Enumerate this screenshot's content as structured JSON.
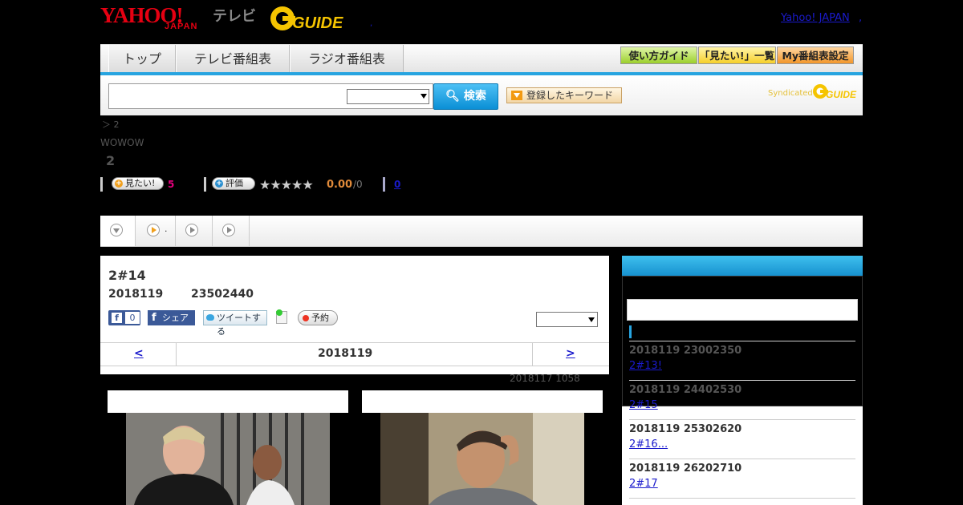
{
  "header": {
    "logo_yahoo": "YAHOO!",
    "logo_japan": "JAPAN",
    "logo_tv": "テレビ",
    "comma": ",",
    "yahoo_japan_link": "Yahoo! JAPAN",
    "yahoo_japan_link_suffix": ","
  },
  "nav": {
    "tabs": [
      "トップ",
      "テレビ番組表",
      "ラジオ番組表"
    ],
    "buttons": [
      "使い方ガイド",
      "「見たい!」一覧",
      "My番組表設定"
    ]
  },
  "search": {
    "button_label": "検索",
    "keyword_button_label": "登録したキーワード",
    "syndicated_label": "Syndicated"
  },
  "program": {
    "breadcrumb": "＞ 2",
    "channel": "WOWOW",
    "title": "2",
    "want_label": "見たい!",
    "want_count": "5",
    "rate_label": "評価",
    "stars": "★★★★★",
    "rating": "0.00",
    "rating_count": "/0",
    "review_count": "0"
  },
  "tabs_strip": {
    "tab2_label": "."
  },
  "episode": {
    "title": "2#14",
    "date": "2018119",
    "time": "23502440",
    "fb_like_count": "0",
    "fb_share_label": "シェア",
    "tweet_label": "ツイートする",
    "reserve_label": "予約"
  },
  "date_nav": {
    "prev": "<",
    "current": "2018119",
    "next": ">"
  },
  "updated": "2018117  1058",
  "sidebar": {
    "episodes": [
      {
        "datetime": "2018119  23002350",
        "link": "2#13!"
      },
      {
        "datetime": "2018119  24402530",
        "link": "2#15"
      },
      {
        "datetime": "2018119  25302620",
        "link": "2#16..."
      },
      {
        "datetime": "2018119  26202710",
        "link": "2#17"
      }
    ]
  },
  "colors": {
    "accent_blue": "#27a4e0",
    "yahoo_red": "#e60012",
    "gguide_yellow": "#f5c400",
    "link": "#1a1acc"
  }
}
